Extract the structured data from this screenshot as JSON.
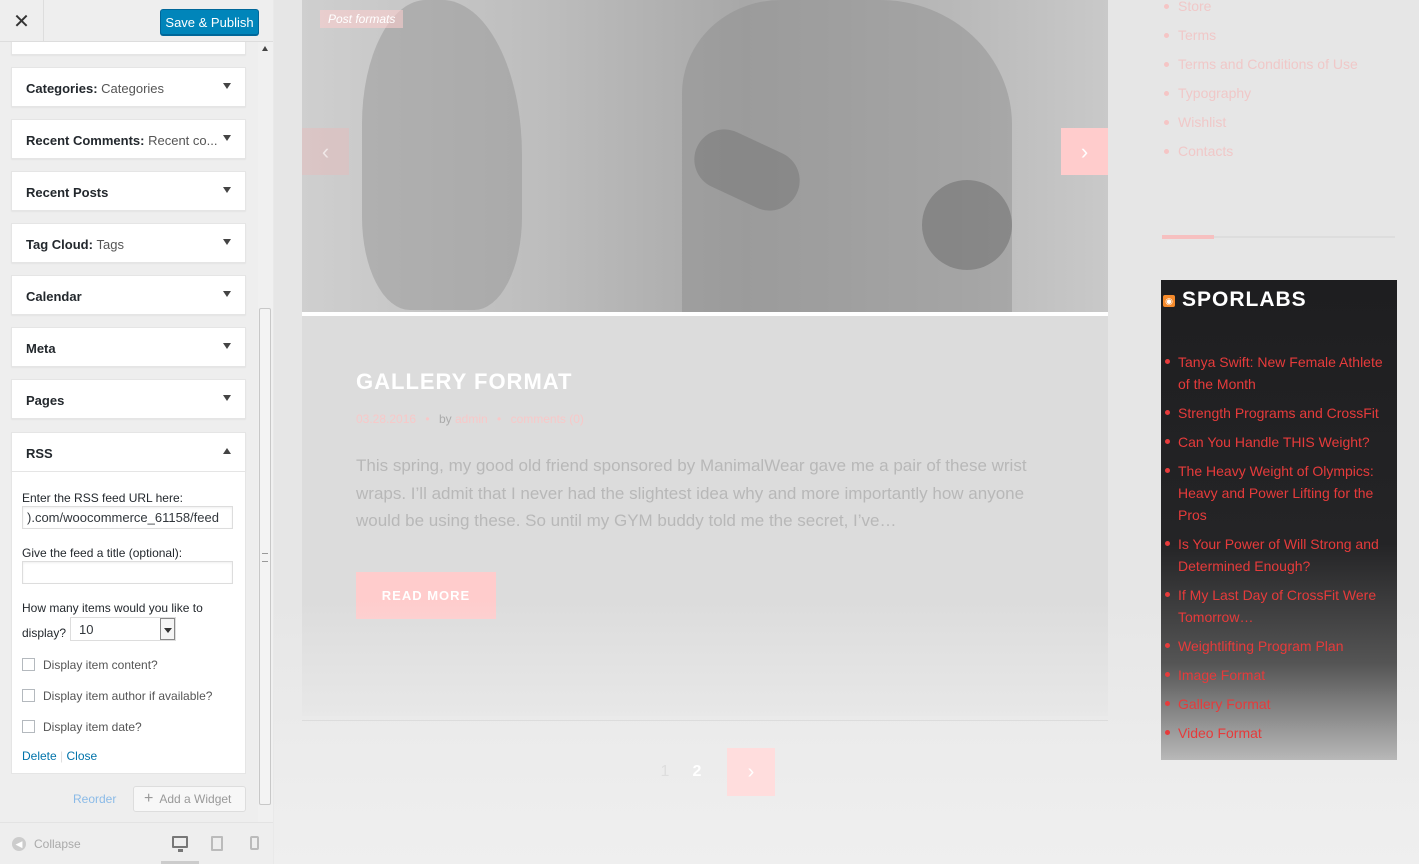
{
  "header": {
    "close_icon": "close-icon",
    "save_label": "Save & Publish"
  },
  "widgets": [
    {
      "title": "Categories",
      "sub": "Categories"
    },
    {
      "title": "Recent Comments",
      "sub": "Recent co..."
    },
    {
      "title": "Recent Posts",
      "sub": ""
    },
    {
      "title": "Tag Cloud",
      "sub": "Tags"
    },
    {
      "title": "Calendar",
      "sub": ""
    },
    {
      "title": "Meta",
      "sub": ""
    },
    {
      "title": "Pages",
      "sub": ""
    },
    {
      "title": "RSS",
      "sub": ""
    }
  ],
  "rss_form": {
    "url_label": "Enter the RSS feed URL here:",
    "url_value": ").com/woocommerce_61158/feed",
    "title_label": "Give the feed a title (optional):",
    "title_value": "",
    "items_label_1": "How many items would you like to",
    "items_label_2": "display?",
    "items_value": "10",
    "cb_content": "Display item content?",
    "cb_author": "Display item author if available?",
    "cb_date": "Display item date?",
    "delete": "Delete",
    "sep": "|",
    "close": "Close"
  },
  "footer": {
    "reorder": "Reorder",
    "add_widget": "Add a Widget",
    "collapse": "Collapse"
  },
  "preview": {
    "hero_badge": "Post formats",
    "post_title": "GALLERY FORMAT",
    "post_date": "03.28.2016",
    "post_by": "by",
    "post_author": "admin",
    "post_comments": "comments (0)",
    "post_excerpt": "This spring, my good old friend sponsored by ManimalWear gave me a pair of these wrist wraps. I’ll admit that I never had the slightest idea why and more importantly how anyone would be using these. So until my GYM buddy told me the secret, I’ve…",
    "read_more": "READ MORE",
    "pager": [
      "1",
      "2"
    ],
    "menu": [
      "Store",
      "Terms",
      "Terms and Conditions of Use",
      "Typography",
      "Wishlist",
      "Contacts"
    ],
    "rss_title": "SPORLABS",
    "rss_items": [
      "Tanya Swift: New Female Athlete of the Month",
      "Strength Programs and CrossFit",
      "Can You Handle THIS Weight?",
      "The Heavy Weight of Olympics: Heavy and Power Lifting for the Pros",
      "Is Your Power of Will Strong and Determined Enough?",
      "If My Last Day of CrossFit Were Tomorrow…",
      "Weightlifting Program Plan",
      "Image Format",
      "Gallery Format",
      "Video Format"
    ]
  }
}
